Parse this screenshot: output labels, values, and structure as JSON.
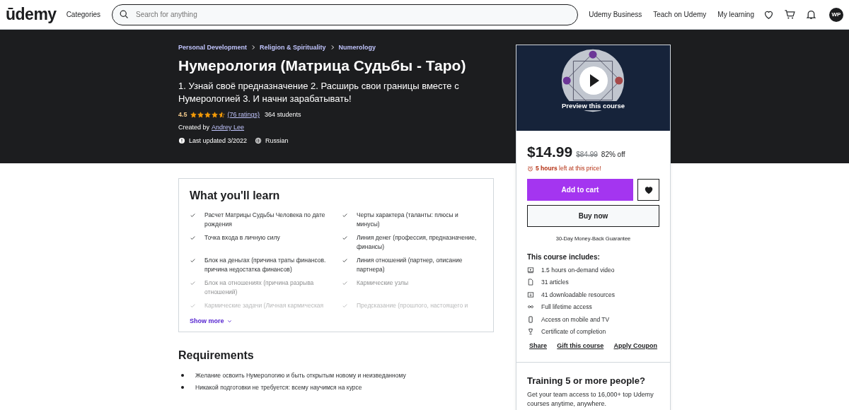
{
  "header": {
    "logo": "ūdemy",
    "categories": "Categories",
    "search": {
      "placeholder": "Search for anything"
    },
    "links": [
      "Udemy Business",
      "Teach on Udemy",
      "My learning"
    ],
    "avatar": "WP"
  },
  "course": {
    "breadcrumbs": [
      "Personal Development",
      "Religion & Spirituality",
      "Numerology"
    ],
    "title": "Нумерология (Матрица Судьбы - Таро)",
    "subtitle": "1. Узнай своё предназначение 2. Расширь свои границы вместе с Нумерологией 3. И начни зарабатывать!",
    "rating": "4.5",
    "stars": 4.5,
    "ratings_link": "(76 ratings)",
    "students": "364 students",
    "created_by": "Created by",
    "author": "Andrey Lee",
    "last_updated": "Last updated 3/2022",
    "language": "Russian"
  },
  "learn": {
    "title": "What you'll learn",
    "items": [
      {
        "text": "Расчет Матрицы Судьбы Человека по дате рождения",
        "kind": "full"
      },
      {
        "text": "Черты характера (таланты: плюсы и минусы)",
        "kind": "full"
      },
      {
        "text": "Точка входа в личную силу",
        "kind": "full"
      },
      {
        "text": "Линия денег (профессия, предназначение, финансы)",
        "kind": "full"
      },
      {
        "text": "Блок на деньгах (причина траты финансов. причина недостатка финансов)",
        "kind": "full"
      },
      {
        "text": "Линия отношений (партнер, описание партнера)",
        "kind": "full"
      },
      {
        "text": "Блок на отношениях (причина разрыва отношений)",
        "kind": "dim"
      },
      {
        "text": "Кармические узлы",
        "kind": "dim"
      },
      {
        "text": "Кармические задачи (Личная кармическая",
        "kind": "faint"
      },
      {
        "text": "Предсказание (прошлого, настоящего и",
        "kind": "faint"
      }
    ],
    "show_more": "Show more"
  },
  "requirements": {
    "title": "Requirements",
    "items": [
      "Желание освоить Нумерологию и быть открытым новому и неизведанному",
      "Никакой подготовки не требуется: всему научимся на курсе"
    ]
  },
  "sidebar": {
    "preview": "Preview this course",
    "price": "$14.99",
    "old_price": "$84.99",
    "discount": "82% off",
    "timer_bold": "5 hours",
    "timer_rest": "left at this price!",
    "add_to_cart": "Add to cart",
    "buy_now": "Buy now",
    "guarantee": "30-Day Money-Back Guarantee",
    "includes_title": "This course includes:",
    "includes": [
      {
        "kind": "video",
        "text": "1.5 hours on-demand video"
      },
      {
        "kind": "article",
        "text": "31 articles"
      },
      {
        "kind": "download",
        "text": "41 downloadable resources"
      },
      {
        "kind": "infinity",
        "text": "Full lifetime access"
      },
      {
        "kind": "mobile",
        "text": "Access on mobile and TV"
      },
      {
        "kind": "trophy",
        "text": "Certificate of completion"
      }
    ],
    "actions": [
      "Share",
      "Gift this course",
      "Apply Coupon"
    ],
    "team_title": "Training 5 or more people?",
    "team_text": "Get your team access to 16,000+ top Udemy courses anytime, anywhere."
  }
}
